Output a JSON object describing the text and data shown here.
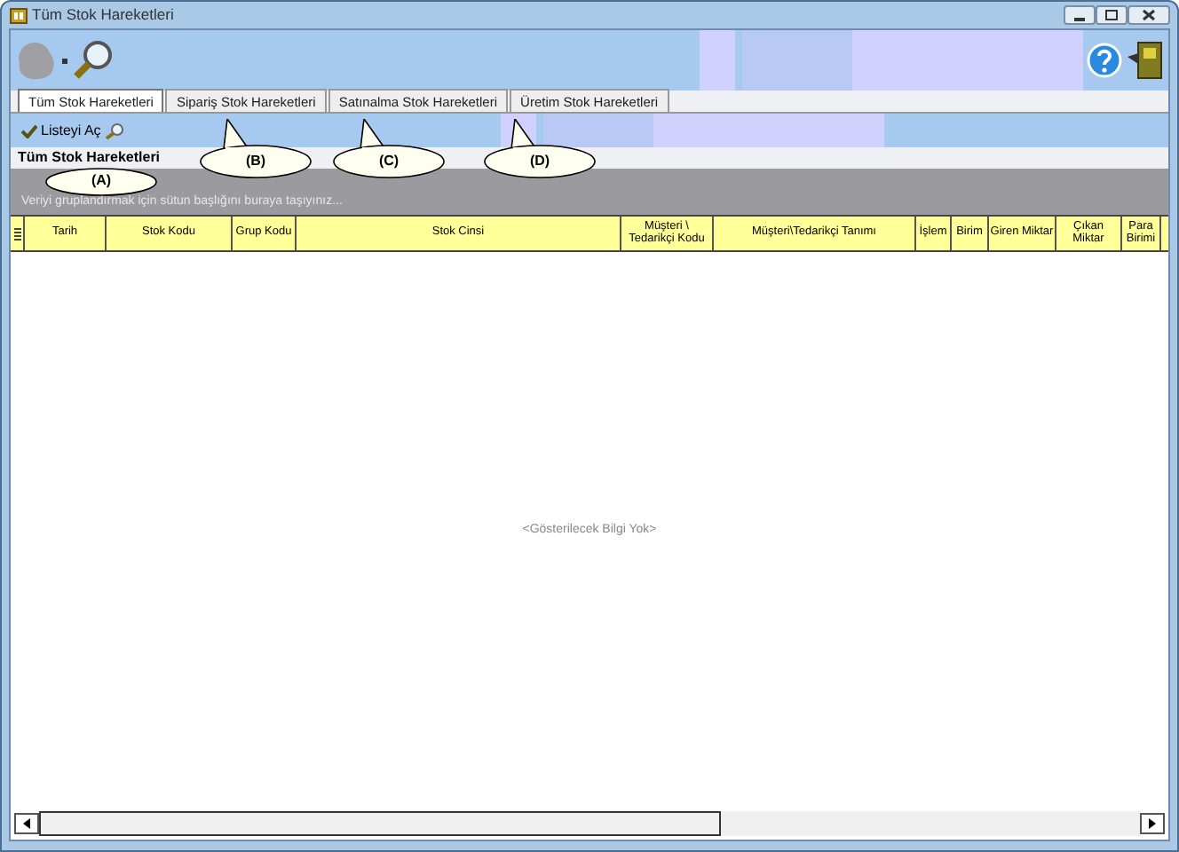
{
  "window": {
    "title": "Tüm Stok Hareketleri"
  },
  "tabs": [
    {
      "label": "Tüm Stok Hareketleri",
      "selected": true
    },
    {
      "label": "Sipariş Stok Hareketleri",
      "selected": false
    },
    {
      "label": "Satınalma Stok Hareketleri",
      "selected": false
    },
    {
      "label": "Üretim Stok Hareketleri",
      "selected": false
    }
  ],
  "toolbar": {
    "open_list": "Listeyi Aç"
  },
  "group_title": "Tüm Stok Hareketleri",
  "group_hint": "Veriyi gruplandırmak için sütun başlığını buraya taşıyınız...",
  "table": {
    "columns": [
      "Tarih",
      "Stok Kodu",
      "Grup Kodu",
      "Stok Cinsi",
      "Müşteri \\ Tedarikçi Kodu",
      "Müşteri\\Tedarikçi Tanımı",
      "İşlem",
      "Birim",
      "Giren Miktar",
      "Çıkan Miktar",
      "Para Birimi"
    ],
    "empty_text": "<Gösterilecek Bilgi Yok>"
  },
  "callouts": [
    {
      "label": "(A)"
    },
    {
      "label": "(B)"
    },
    {
      "label": "(C)"
    },
    {
      "label": "(D)"
    }
  ]
}
